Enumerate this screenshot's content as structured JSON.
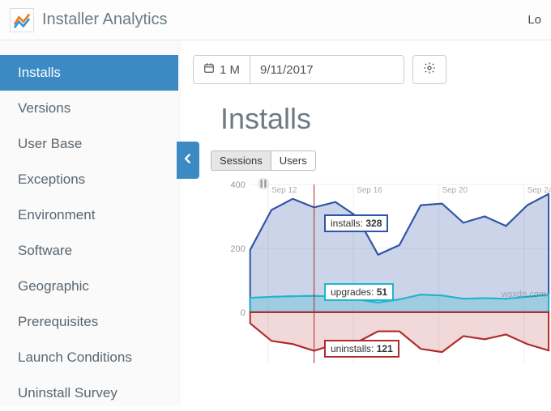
{
  "header": {
    "app_title": "Installer Analytics",
    "login": "Lo"
  },
  "sidebar": {
    "items": [
      {
        "label": "Installs",
        "active": true
      },
      {
        "label": "Versions",
        "active": false
      },
      {
        "label": "User Base",
        "active": false
      },
      {
        "label": "Exceptions",
        "active": false
      },
      {
        "label": "Environment",
        "active": false
      },
      {
        "label": "Software",
        "active": false
      },
      {
        "label": "Geographic",
        "active": false
      },
      {
        "label": "Prerequisites",
        "active": false
      },
      {
        "label": "Launch Conditions",
        "active": false
      },
      {
        "label": "Uninstall Survey",
        "active": false
      }
    ]
  },
  "toolbar": {
    "range_label": "1 M",
    "date_value": "9/11/2017"
  },
  "page": {
    "title": "Installs",
    "tabs": {
      "sessions": "Sessions",
      "users": "Users",
      "active": "sessions"
    }
  },
  "tooltips": {
    "installs_label": "installs:",
    "installs_value": "328",
    "upgrades_label": "upgrades:",
    "upgrades_value": "51",
    "uninstalls_label": "uninstalls:",
    "uninstalls_value": "121"
  },
  "watermark": "wsxdn.com",
  "chart_data": {
    "type": "line",
    "xlabel": "",
    "ylabel": "",
    "ylim": [
      -150,
      400
    ],
    "y_ticks": [
      0,
      200,
      400
    ],
    "x_ticks": [
      "Sep 12",
      "Sep 16",
      "Sep 20",
      "Sep 24"
    ],
    "cursor_x_index": 3,
    "series": [
      {
        "name": "installs",
        "color": "#2f55a5",
        "values": [
          195,
          320,
          355,
          328,
          345,
          300,
          180,
          210,
          335,
          340,
          280,
          300,
          270,
          335,
          370
        ]
      },
      {
        "name": "upgrades",
        "color": "#1fb5cc",
        "values": [
          45,
          48,
          50,
          51,
          49,
          40,
          30,
          40,
          55,
          52,
          42,
          44,
          42,
          48,
          55
        ]
      },
      {
        "name": "uninstalls",
        "color": "#b02a2a",
        "values": [
          -35,
          -90,
          -100,
          -121,
          -100,
          -95,
          -60,
          -60,
          -115,
          -125,
          -75,
          -85,
          -70,
          -100,
          -120
        ]
      }
    ]
  }
}
